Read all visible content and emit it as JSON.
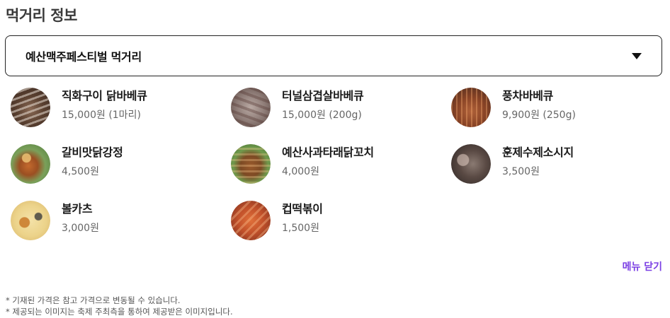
{
  "section": {
    "title": "먹거리 정보"
  },
  "select": {
    "value": "예산맥주페스티벌 먹거리"
  },
  "items": [
    {
      "name": "직화구이 닭바베큐",
      "price": "15,000원 (1마리)",
      "thumb": "grilled-chicken-skewers"
    },
    {
      "name": "터널삼겹살바베큐",
      "price": "15,000원 (200g)",
      "thumb": "tunnel-pork-belly"
    },
    {
      "name": "풍차바베큐",
      "price": "9,900원 (250g)",
      "thumb": "windmill-barbecue"
    },
    {
      "name": "갈비맛닭강정",
      "price": "4,500원",
      "thumb": "galbi-fried-chicken"
    },
    {
      "name": "예산사과타래닭꼬치",
      "price": "4,000원",
      "thumb": "apple-chicken-skewers"
    },
    {
      "name": "훈제수제소시지",
      "price": "3,500원",
      "thumb": "smoked-sausage"
    },
    {
      "name": "볼카츠",
      "price": "3,000원",
      "thumb": "ball-katsu"
    },
    {
      "name": "컵떡볶이",
      "price": "1,500원",
      "thumb": "cup-tteokbokki"
    }
  ],
  "actions": {
    "close_menu": "메뉴 닫기"
  },
  "notes": [
    "* 기재된 가격은 참고 가격으로 변동될 수 있습니다.",
    "* 제공되는 이미지는 축제 주최측을 통하여 제공받은 이미지입니다."
  ]
}
